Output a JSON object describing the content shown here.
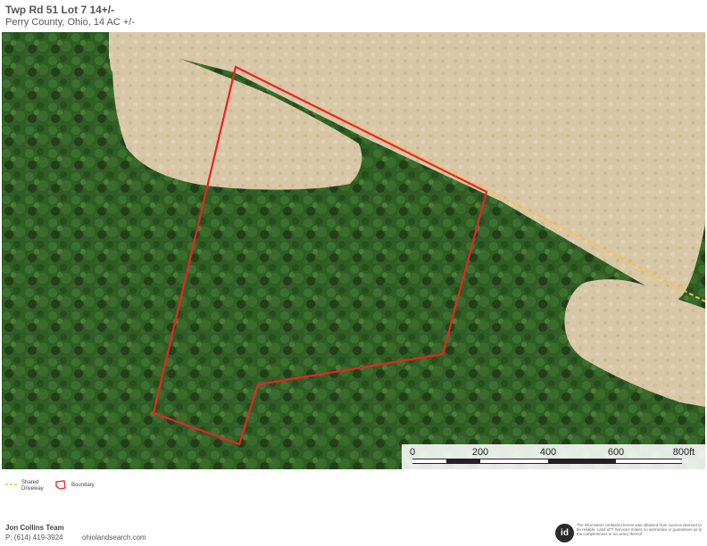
{
  "header": {
    "title": "Twp Rd 51 Lot 7 14+/-",
    "subtitle": "Perry County, Ohio, 14 AC +/-"
  },
  "map": {
    "layer": "satellite-imagery",
    "boundary_color": "#e8232a",
    "driveway_color": "#f2c14e",
    "scale": {
      "labels": [
        "0",
        "200",
        "400",
        "600",
        "800ft"
      ]
    }
  },
  "legend": {
    "items": [
      {
        "label_line1": "Shared",
        "label_line2": "Driveway",
        "icon": "dashed-line-icon",
        "color": "#f2c14e"
      },
      {
        "label": "Boundary",
        "icon": "boundary-polygon-icon",
        "color": "#e8232a"
      }
    ]
  },
  "footer": {
    "team": "Jon Collins Team",
    "phone": "P: (614) 419-3924",
    "website": "ohiolandsearch.com",
    "logo_text": "id",
    "disclaimer": "The information contained herein was obtained from sources deemed to be reliable. Land id™ Services makes no warranties or guarantees as to the completeness or accuracy thereof."
  }
}
